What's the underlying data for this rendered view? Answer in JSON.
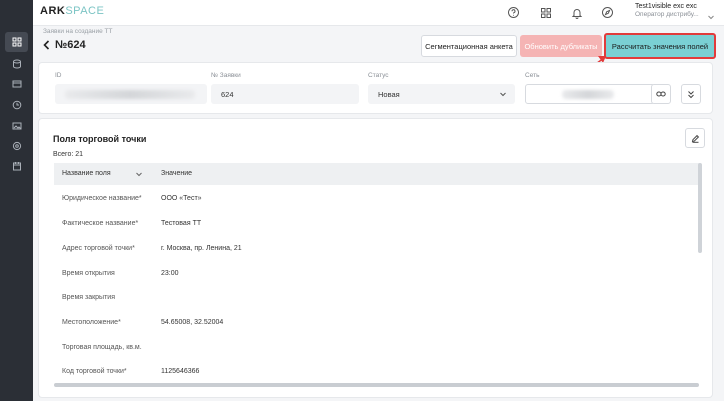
{
  "header": {
    "logo_ark": "ARK",
    "logo_space": "SPACE",
    "user_name": "Test1visible exc exc",
    "user_role": "Оператор дистрибу..."
  },
  "breadcrumb": "Заявки на создание ТТ",
  "page_title": "№624",
  "actions": {
    "segmentation": "Сегментационная анкета",
    "update_duplicates": "Обновить дубликаты",
    "calculate": "Рассчитать значения полей"
  },
  "form": {
    "id_label": "ID",
    "request_label": "№ Заявки",
    "request_value": "624",
    "status_label": "Статус",
    "status_value": "Новая",
    "network_label": "Сеть"
  },
  "section": {
    "title": "Поля торговой точки",
    "total": "Всего: 21",
    "col_name": "Название поля",
    "col_value": "Значение",
    "rows": [
      {
        "name": "Юридическое название*",
        "value": "ООО «Тест»"
      },
      {
        "name": "Фактическое название*",
        "value": "Тестовая ТТ"
      },
      {
        "name": "Адрес торговой точки*",
        "value": "г. Москва, пр. Ленина, 21"
      },
      {
        "name": "Время открытия",
        "value": "23:00"
      },
      {
        "name": "Время закрытия",
        "value": ""
      },
      {
        "name": "Местоположение*",
        "value": "54.65008, 32.52004"
      },
      {
        "name": "Торговая площадь, кв.м.",
        "value": ""
      },
      {
        "name": "Код торговой точки*",
        "value": "1125646366"
      }
    ]
  },
  "colors": {
    "accent": "#7ad0d4",
    "highlight": "#e23b3b",
    "sidebar": "#2b2f36"
  },
  "icons": [
    "dashboard-icon",
    "database-icon",
    "card-icon",
    "clock-icon",
    "image-icon",
    "settings-icon",
    "calendar-icon",
    "support-icon",
    "apps-icon",
    "bell-icon",
    "compass-icon"
  ]
}
